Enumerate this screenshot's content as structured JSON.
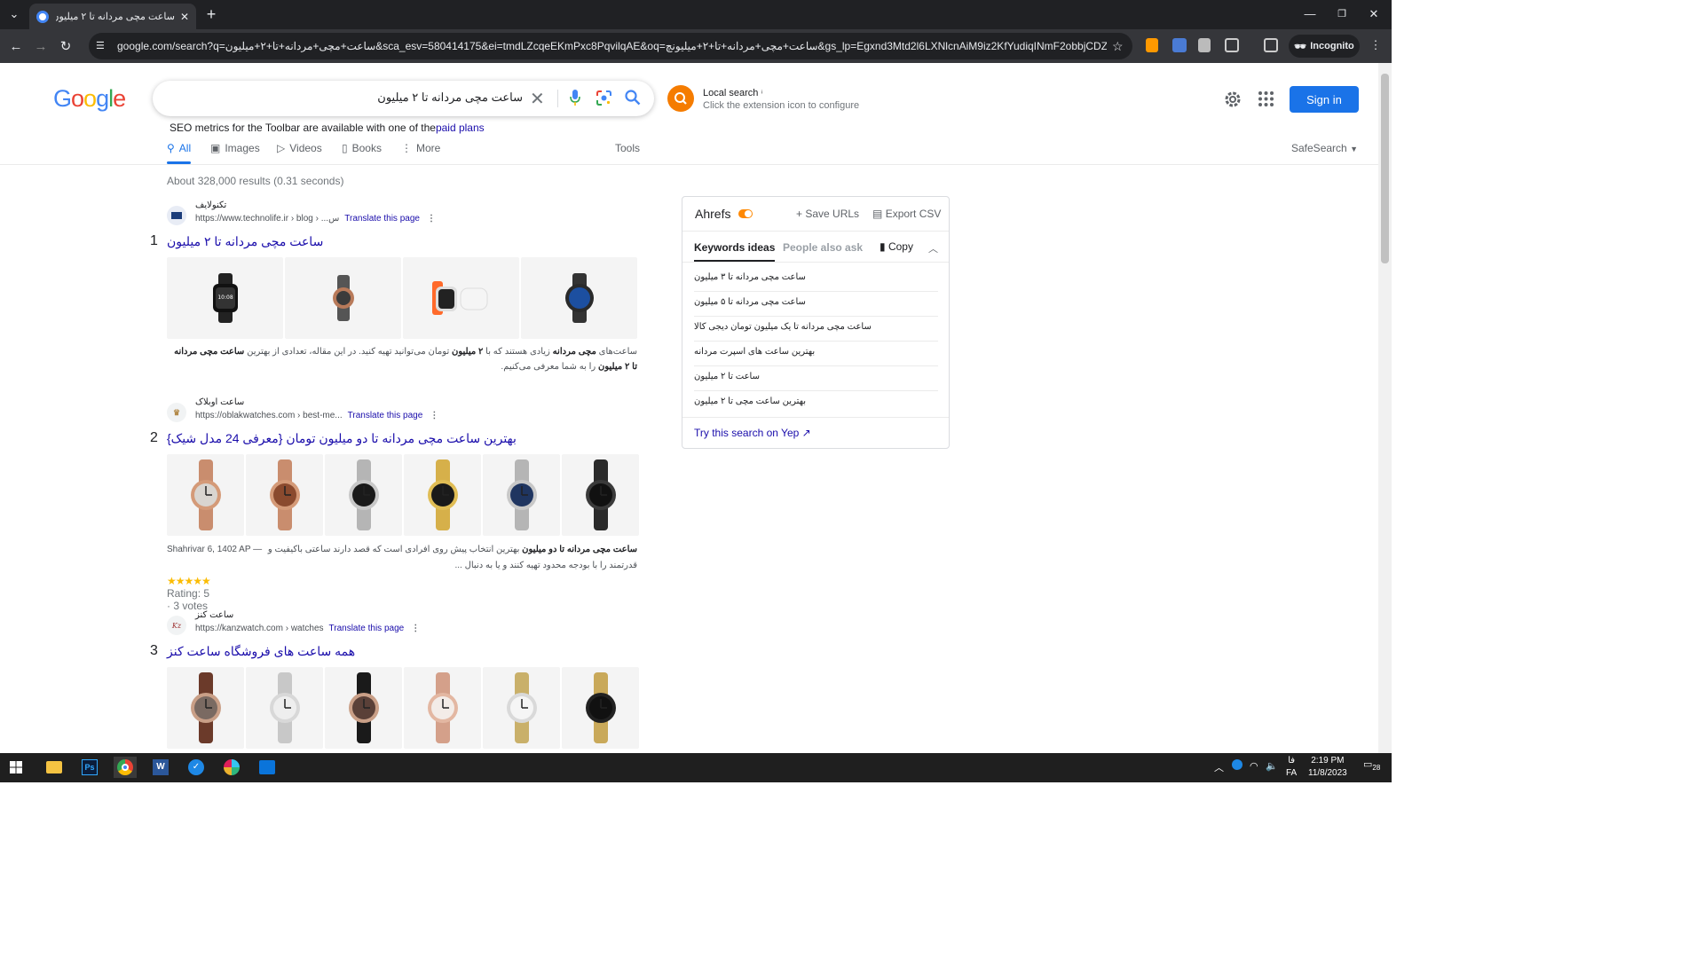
{
  "browser": {
    "tab_title": "ساعت مچی مردانه تا ۲ میلیون - Google",
    "url": "google.com/search?q=ساعت+مچی+مردانه+تا+۲+میلیون&sca_esv=580414175&ei=tmdLZcqeEKmPxc8PqvilqAE&oq=ساعت+مچی+مردانه+تا+۲+میلیونچ&gs_lp=Egxnd3Mtd2l6LXNlcnAiM9iz2KfYudiqINmF2obbjCDZhdix2K_Y...",
    "incognito_label": "Incognito"
  },
  "google": {
    "logo": "Google",
    "query": "ساعت مچی مردانه تا ۲ میلیون",
    "local_search_title": "Local search",
    "local_search_sub": "Click the extension icon to configure",
    "sign_in": "Sign in",
    "seo_text": "SEO metrics for the Toolbar are available with one of the",
    "seo_link": "paid plans",
    "tabs": [
      "All",
      "Images",
      "Videos",
      "Books",
      "More"
    ],
    "tools": "Tools",
    "safesearch": "SafeSearch",
    "stats": "About 328,000 results (0.31 seconds)"
  },
  "results": [
    {
      "num": "1",
      "site": "تکنولایف",
      "cite": "https://www.technolife.ir › blog › ...س",
      "translate": "Translate this page",
      "title": "ساعت مچی مردانه تا ۲ میلیون",
      "snippet_html": "ساعت‌های <b>مچی مردانه</b> زیادی هستند که با <b>۲ میلیون</b> تومان می‌توانید تهیه کنید. در این مقاله، تعدادی از بهترین <b>ساعت مچی مردانه تا ۲ میلیون</b> را به شما معرفی می‌کنیم."
    },
    {
      "num": "2",
      "site": "ساعت اوبلاک",
      "cite": "https://oblakwatches.com › best-me...",
      "translate": "Translate this page",
      "title": "بهترین ساعت مچی مردانه تا دو میلیون تومان {معرفی 24 مدل شیک}",
      "date": "Shahrivar 6, 1402 AP —",
      "snippet_html": "<b>ساعت مچی مردانه تا دو میلیون</b> بهترین انتخاب پیش روی افرادی است که قصد دارند ساعتی باکیفیت و قدرتمند را با بودجه محدود تهیه کنند و یا به دنبال ...",
      "rating_stars": "★★★★★",
      "rating_text": "Rating: 5 · 3 votes"
    },
    {
      "num": "3",
      "site": "ساعت کنز",
      "cite": "https://kanzwatch.com › watches",
      "translate": "Translate this page",
      "title": "همه ساعت های فروشگاه ساعت کنز"
    }
  ],
  "ahrefs": {
    "title": "Ahrefs",
    "save_urls": "Save URLs",
    "export_csv": "Export CSV",
    "tab_keywords": "Keywords ideas",
    "tab_paa": "People also ask",
    "copy": "Copy",
    "keywords": [
      "ساعت مچی مردانه تا ۳ میلیون",
      "ساعت مچی مردانه تا ۵ میلیون",
      "ساعت مچی مردانه تا یک میلیون تومان دیجی کالا",
      "بهترین ساعت های اسپرت مردانه",
      "ساعت تا ۲ میلیون",
      "بهترین ساعت مچی تا ۲ میلیون"
    ],
    "yep_link": "Try this search on Yep"
  },
  "taskbar": {
    "time": "2:19 PM",
    "date": "11/8/2023",
    "lang_top": "فا",
    "lang_bottom": "FA",
    "notif_count": "28"
  },
  "colors": {
    "accent": "#1a73e8",
    "link": "#1a0dab",
    "ahrefs_orange": "#ff8800"
  }
}
